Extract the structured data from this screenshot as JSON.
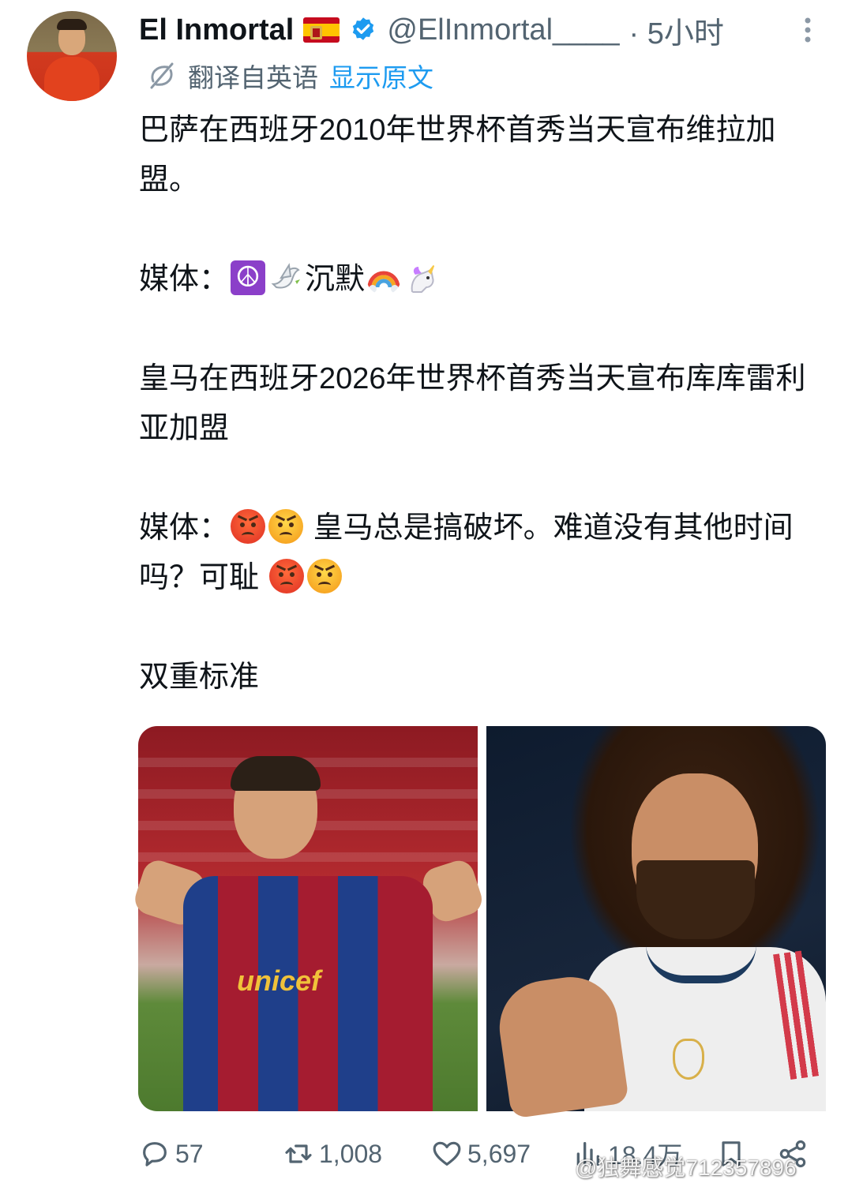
{
  "author": {
    "display_name": "El Inmortal",
    "flag_icon": "spain-flag-icon",
    "verified_icon": "verified-badge-icon",
    "handle": "@ElInmortal____",
    "time": "· 5小时"
  },
  "translation": {
    "label": "翻译自英语",
    "show_original": "显示原文"
  },
  "tweet": {
    "p1": "巴萨在西班牙2010年世界杯首秀当天宣布维拉加盟。",
    "p2_prefix": "媒体：",
    "p2_word": "沉默",
    "p3": "皇马在西班牙2026年世界杯首秀当天宣布库库雷利亚加盟",
    "p4_prefix": "媒体：",
    "p4_middle": " 皇马总是搞破坏。难道没有其他时间吗？可耻 ",
    "p5": "双重标准"
  },
  "media": {
    "left_caption": "unicef"
  },
  "actions": {
    "reply_count": "57",
    "retweet_count": "1,008",
    "like_count": "5,697",
    "views_count": "18.4万"
  },
  "watermark": "@独舞感觉712357896",
  "colors": {
    "text": "#0f1419",
    "secondary": "#536471",
    "link": "#1d9bf0"
  }
}
